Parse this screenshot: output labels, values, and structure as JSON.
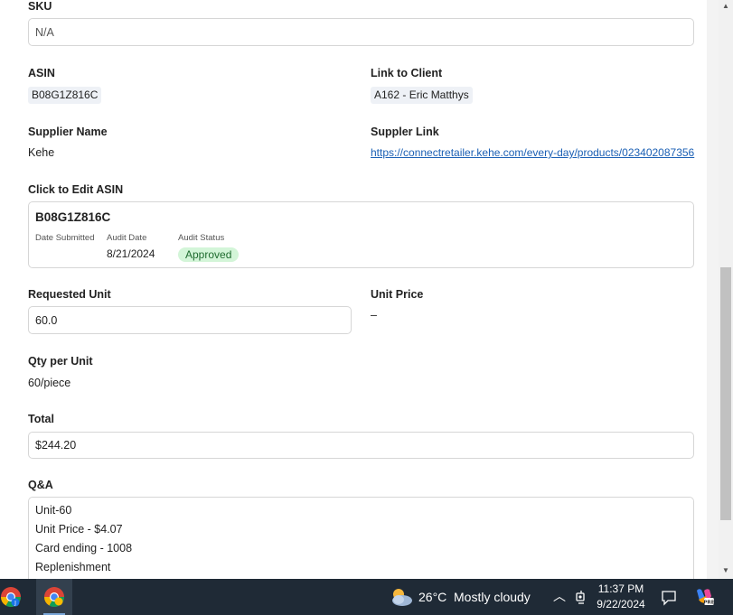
{
  "form": {
    "sku": {
      "label": "SKU",
      "placeholder": "N/A"
    },
    "asin": {
      "label": "ASIN",
      "value": "B08G1Z816C"
    },
    "link_to_client": {
      "label": "Link to Client",
      "value": "A162 - Eric Matthys"
    },
    "supplier_name": {
      "label": "Supplier Name",
      "value": "Kehe"
    },
    "supplier_link": {
      "label": "Suppler Link",
      "value": "https://connectretailer.kehe.com/every-day/products/023402087356"
    },
    "edit_asin": {
      "label": "Click to Edit ASIN",
      "asin": "B08G1Z816C",
      "date_submitted_label": "Date Submitted",
      "audit_date_label": "Audit Date",
      "audit_date": "8/21/2024",
      "audit_status_label": "Audit Status",
      "audit_status": "Approved"
    },
    "requested_unit": {
      "label": "Requested Unit",
      "value": "60.0"
    },
    "unit_price": {
      "label": "Unit Price",
      "value": "–"
    },
    "qty_per_unit": {
      "label": "Qty per Unit",
      "value": "60/piece"
    },
    "total": {
      "label": "Total",
      "value": "$244.20"
    },
    "qa": {
      "label": "Q&A",
      "lines": [
        "Unit-60",
        "Unit Price - $4.07",
        "Card ending - 1008",
        "Replenishment"
      ]
    }
  },
  "taskbar": {
    "weather_temp": "26°C",
    "weather_desc": "Mostly cloudy",
    "time": "11:37 PM",
    "date": "9/22/2024"
  },
  "colors": {
    "link": "#1a5fb4",
    "badge_bg": "#d3f5d8",
    "badge_text": "#1e6b2e",
    "taskbar": "#1f2a36"
  }
}
